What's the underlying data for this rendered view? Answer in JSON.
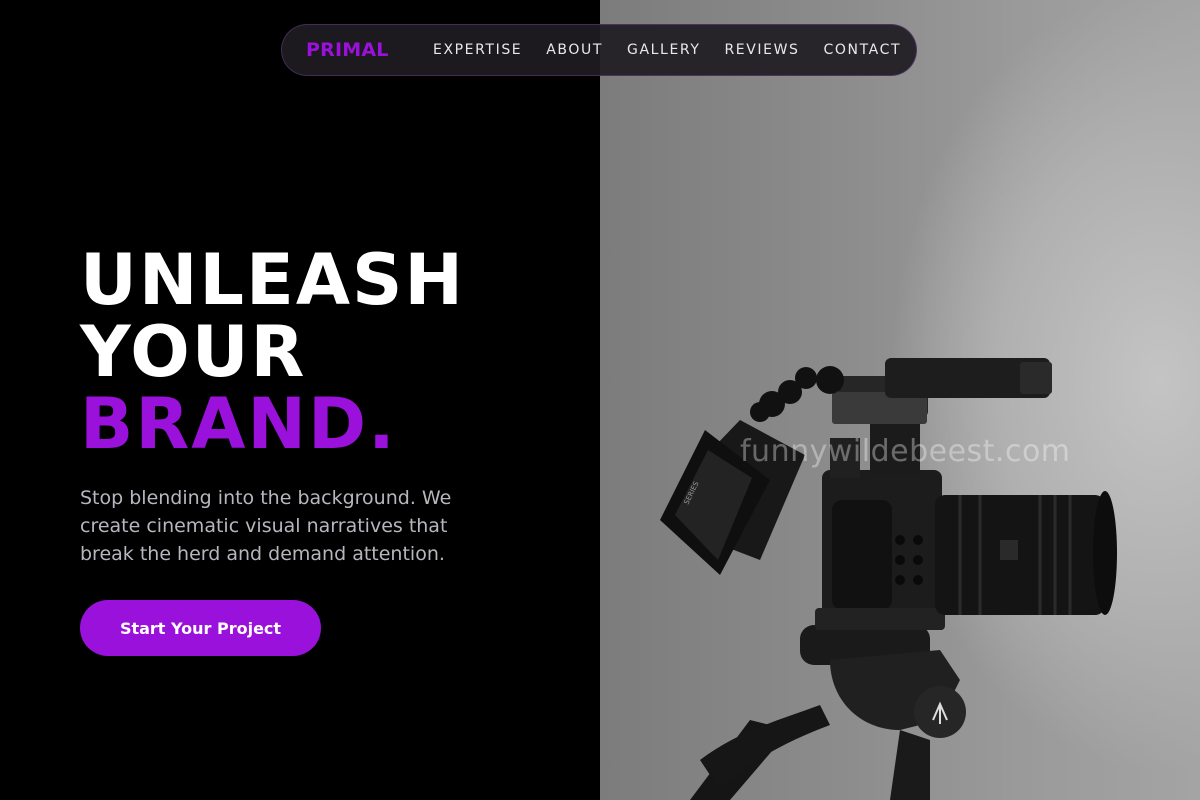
{
  "nav": {
    "brand": "PRIMAL",
    "links": [
      "EXPERTISE",
      "ABOUT",
      "GALLERY",
      "REVIEWS",
      "CONTACT"
    ]
  },
  "hero": {
    "title_line1": "UNLEASH",
    "title_line2": "YOUR",
    "title_accent": "BRAND.",
    "subtitle": "Stop blending into the background. We create cinematic visual narratives that break the herd and demand attention.",
    "cta_label": "Start Your Project"
  },
  "photo": {
    "watermark": "funnywildebeest.com",
    "subject": "cinema-camera-on-tripod"
  },
  "colors": {
    "accent": "#9b11dc",
    "background": "#000000",
    "text": "#ffffff",
    "muted_text": "#b6b6be"
  }
}
